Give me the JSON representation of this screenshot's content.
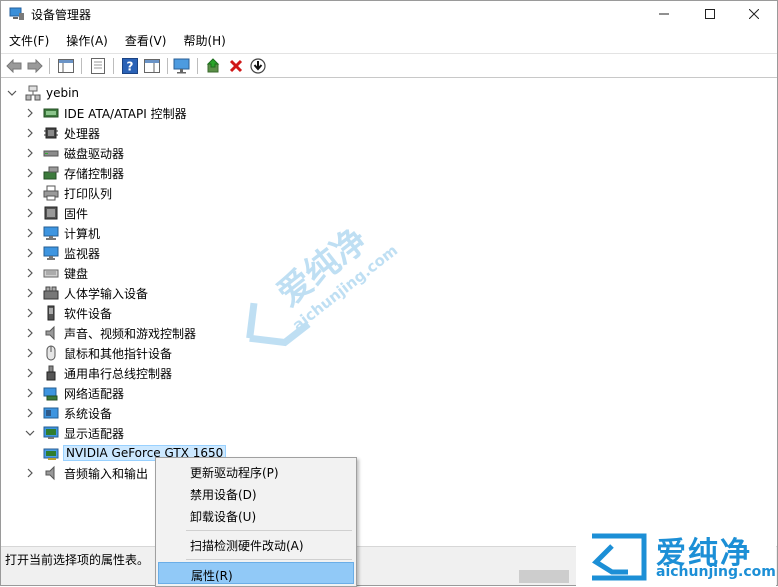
{
  "window": {
    "title": "设备管理器"
  },
  "menu": [
    "文件(F)",
    "操作(A)",
    "查看(V)",
    "帮助(H)"
  ],
  "tree": {
    "root": "yebin",
    "nodes": [
      {
        "label": "IDE ATA/ATAPI 控制器",
        "icon": "ide-controller-icon",
        "expanded": false
      },
      {
        "label": "处理器",
        "icon": "processor-icon",
        "expanded": false
      },
      {
        "label": "磁盘驱动器",
        "icon": "disk-drive-icon",
        "expanded": false
      },
      {
        "label": "存储控制器",
        "icon": "storage-controller-icon",
        "expanded": false
      },
      {
        "label": "打印队列",
        "icon": "printer-icon",
        "expanded": false
      },
      {
        "label": "固件",
        "icon": "firmware-icon",
        "expanded": false
      },
      {
        "label": "计算机",
        "icon": "computer-icon",
        "expanded": false
      },
      {
        "label": "监视器",
        "icon": "monitor-icon",
        "expanded": false
      },
      {
        "label": "键盘",
        "icon": "keyboard-icon",
        "expanded": false
      },
      {
        "label": "人体学输入设备",
        "icon": "hid-icon",
        "expanded": false
      },
      {
        "label": "软件设备",
        "icon": "software-device-icon",
        "expanded": false
      },
      {
        "label": "声音、视频和游戏控制器",
        "icon": "sound-icon",
        "expanded": false
      },
      {
        "label": "鼠标和其他指针设备",
        "icon": "mouse-icon",
        "expanded": false
      },
      {
        "label": "通用串行总线控制器",
        "icon": "usb-icon",
        "expanded": false
      },
      {
        "label": "网络适配器",
        "icon": "network-adapter-icon",
        "expanded": false
      },
      {
        "label": "系统设备",
        "icon": "system-device-icon",
        "expanded": false
      },
      {
        "label": "显示适配器",
        "icon": "display-adapter-icon",
        "expanded": true
      },
      {
        "label": "音频输入和输出",
        "icon": "audio-io-icon",
        "expanded": false
      }
    ],
    "selected_child": "NVIDIA GeForce GTX 1650"
  },
  "context_menu": {
    "items": [
      "更新驱动程序(P)",
      "禁用设备(D)",
      "卸载设备(U)",
      "扫描检测硬件改动(A)",
      "属性(R)"
    ],
    "highlighted": "属性(R)"
  },
  "status": {
    "text": "打开当前选择项的属性表。"
  },
  "watermark": {
    "brand": "爱纯净",
    "url": "aichunjing.com",
    "color": "#1c8fd6"
  }
}
